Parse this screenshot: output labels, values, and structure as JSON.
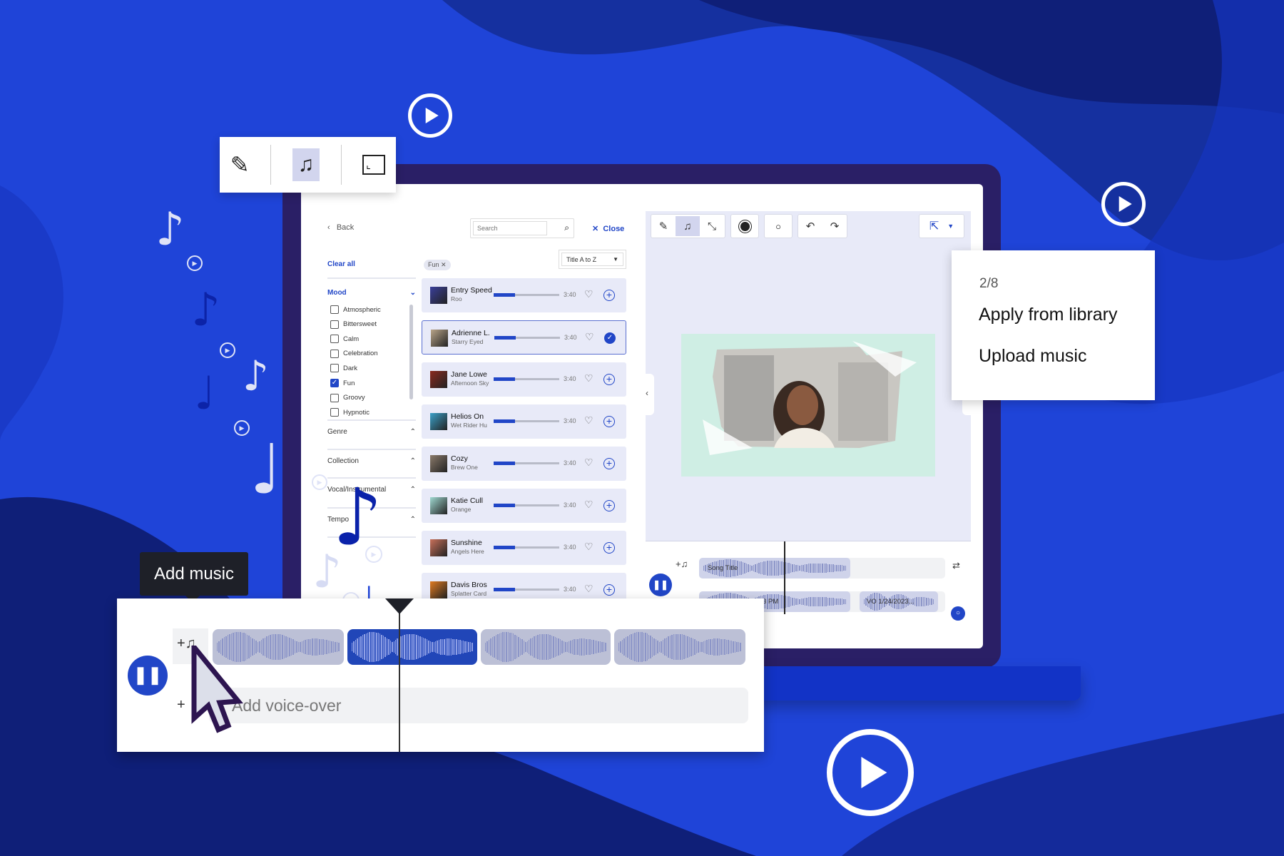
{
  "floating_toolbar": {
    "tools": [
      {
        "icon": "brush-icon"
      },
      {
        "icon": "music-note-icon",
        "active": true
      },
      {
        "icon": "resize-icon"
      }
    ]
  },
  "library": {
    "back_label": "Back",
    "search_placeholder": "Search",
    "close_label": "Close",
    "clear_all_label": "Clear all",
    "active_filter_chip": "Fun",
    "sort_selected": "Title A to Z",
    "mood": {
      "label": "Mood",
      "options": [
        {
          "label": "Atmospheric",
          "checked": false
        },
        {
          "label": "Bittersweet",
          "checked": false
        },
        {
          "label": "Calm",
          "checked": false
        },
        {
          "label": "Celebration",
          "checked": false
        },
        {
          "label": "Dark",
          "checked": false
        },
        {
          "label": "Fun",
          "checked": true
        },
        {
          "label": "Groovy",
          "checked": false
        },
        {
          "label": "Hypnotic",
          "checked": false
        }
      ]
    },
    "sections": [
      "Genre",
      "Collection",
      "Vocal/Instrumental",
      "Tempo"
    ],
    "songs": [
      {
        "title": "Entry Speed",
        "artist": "Roo",
        "duration": "3:40",
        "added": false,
        "thumb": "#3a3f9a"
      },
      {
        "title": "Adrienne L.",
        "artist": "Starry Eyed",
        "duration": "3:40",
        "added": true,
        "thumb": "#b9a58a"
      },
      {
        "title": "Jane Lowe",
        "artist": "Afternoon Sky",
        "duration": "3:40",
        "added": false,
        "thumb": "#8a2a1e"
      },
      {
        "title": "Helios On",
        "artist": "Wet Rider Hu",
        "duration": "3:40",
        "added": false,
        "thumb": "#3aa0c8"
      },
      {
        "title": "Cozy",
        "artist": "Brew One",
        "duration": "3:40",
        "added": false,
        "thumb": "#8a7a6a"
      },
      {
        "title": "Katie Cull",
        "artist": "Orange",
        "duration": "3:40",
        "added": false,
        "thumb": "#9fd8d0"
      },
      {
        "title": "Sunshine",
        "artist": "Angels Here",
        "duration": "3:40",
        "added": false,
        "thumb": "#c8705a"
      },
      {
        "title": "Davis Bros",
        "artist": "Splatter Card",
        "duration": "3:40",
        "added": false,
        "thumb": "#e07a20"
      }
    ],
    "progress_fraction": 0.33
  },
  "editor": {
    "toolbar": [
      "brush-icon",
      "music-note-icon",
      "resize-icon",
      "record-icon",
      "comment-icon",
      "undo-icon",
      "redo-icon"
    ],
    "export_icon": "external-link-icon",
    "timeline": {
      "music_track_label": "Song Title",
      "voice_over_clip_1": "VO 1/24/2023, 3:33 PM",
      "voice_over_clip_2": "VO 1/24/2023..."
    }
  },
  "menu_popup": {
    "step": "2/8",
    "items": [
      "Apply from library",
      "Upload music"
    ]
  },
  "tooltip": "Add music",
  "bottom_timeline": {
    "voice_over_placeholder": "Add voice-over"
  },
  "colors": {
    "accent": "#2146c7",
    "background": "#1f44d8",
    "navy": "#0f1f78"
  }
}
